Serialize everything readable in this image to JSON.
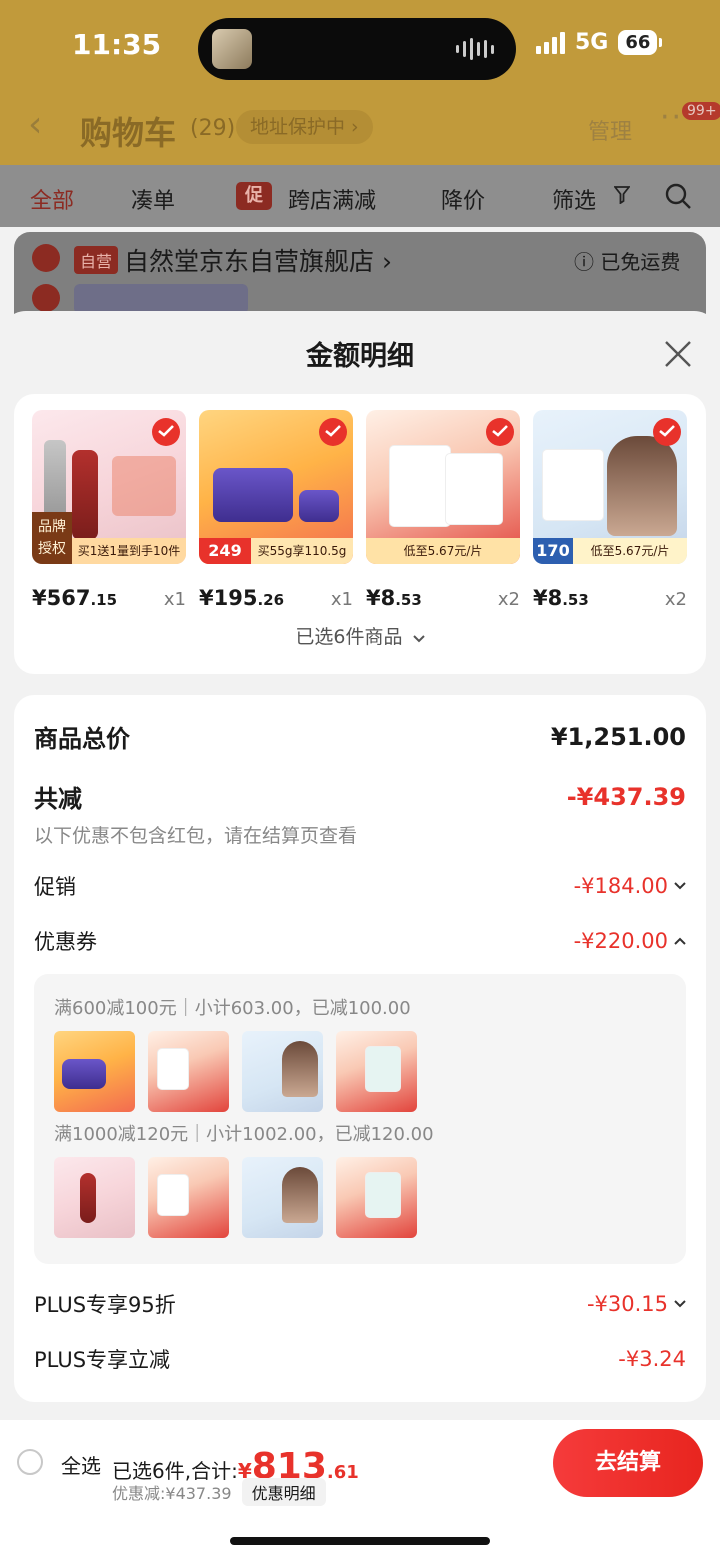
{
  "status_bar": {
    "time": "11:35",
    "network": "5G",
    "battery": "66"
  },
  "nav": {
    "title": "购物车",
    "count": "(29)",
    "address_tag": "地址保护中",
    "manage": "管理",
    "badge": "99+"
  },
  "tabs": [
    {
      "label": "全部"
    },
    {
      "label": "凑单"
    },
    {
      "label": "跨店满减",
      "icon_text": "促"
    },
    {
      "label": "降价"
    },
    {
      "label": "筛选"
    }
  ],
  "store": {
    "tag": "自营",
    "name": "自然堂京东自营旗舰店",
    "shipping": "已免运费"
  },
  "sheet": {
    "title": "金额明细"
  },
  "products": [
    {
      "price_int": "¥567",
      "price_dec": ".15",
      "qty": "x1",
      "ribbon": "买1送1量到手10件",
      "tag": "品牌授权"
    },
    {
      "price_int": "¥195",
      "price_dec": ".26",
      "qty": "x1",
      "ribbon": "买55g享110.5g",
      "tag": "249"
    },
    {
      "price_int": "¥8",
      "price_dec": ".53",
      "qty": "x2",
      "ribbon": "低至5.67元/片",
      "tag": ""
    },
    {
      "price_int": "¥8",
      "price_dec": ".53",
      "qty": "x2",
      "ribbon": "低至5.67元/片",
      "tag": "170"
    }
  ],
  "selected_items_label": "已选6件商品",
  "summary": {
    "total_label": "商品总价",
    "total_value": "¥1,251.00",
    "reduce_label": "共减",
    "reduce_value": "-¥437.39",
    "note": "以下优惠不包含红包，请在结算页查看",
    "promo_label": "促销",
    "promo_value": "-¥184.00",
    "coupon_label": "优惠券",
    "coupon_value": "-¥220.00",
    "coupon_1": "满600减100元｜小计603.00，已减100.00",
    "coupon_2": "满1000减120元｜小计1002.00，已减120.00",
    "plus95_label": "PLUS专享95折",
    "plus95_value": "-¥30.15",
    "plus_cut_label": "PLUS专享立减",
    "plus_cut_value": "-¥3.24"
  },
  "bottom": {
    "select_all": "全选",
    "selected_text": "已选6件,合计:",
    "currency": "¥",
    "total_int": "813",
    "total_dec": ".61",
    "discount_text": "优惠减:¥437.39",
    "detail_label": "优惠明细",
    "checkout": "去结算"
  },
  "colors": {
    "accent": "#e8322b",
    "header_dim": "#c19a3b"
  }
}
